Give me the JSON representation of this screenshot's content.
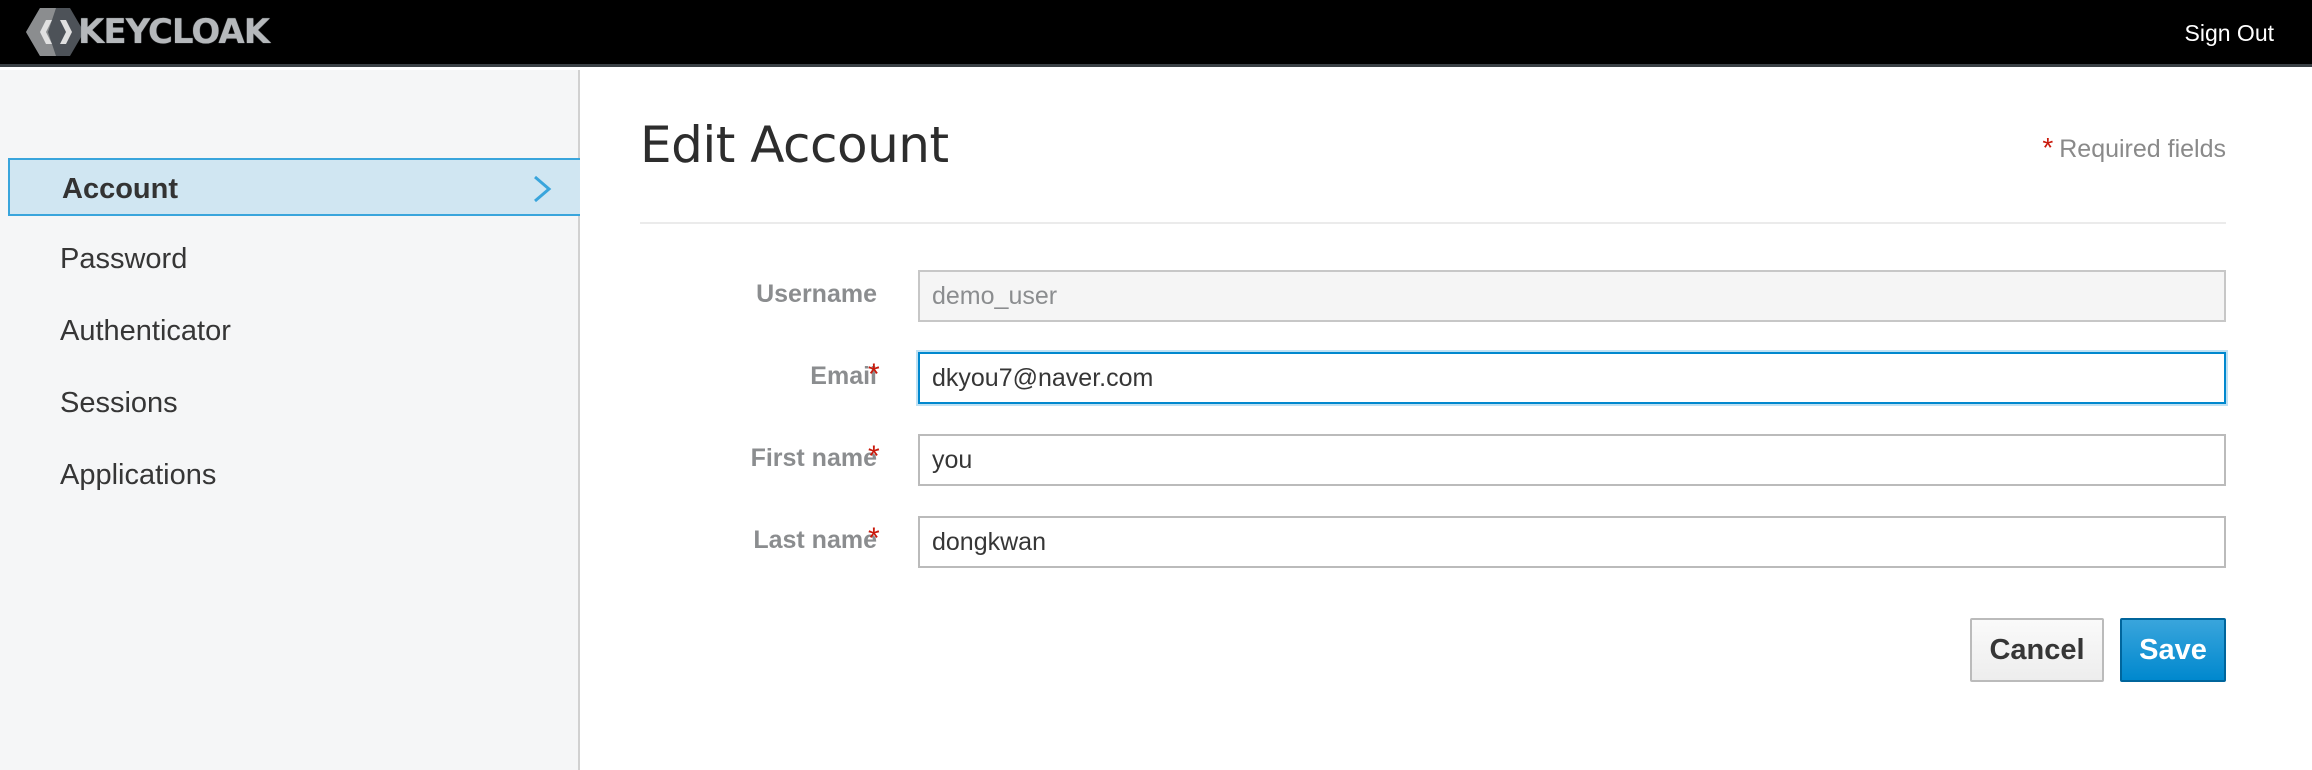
{
  "header": {
    "logo_text": "KEYCLOAK",
    "signout_label": "Sign Out"
  },
  "sidebar": {
    "items": [
      {
        "label": "Account",
        "active": true
      },
      {
        "label": "Password",
        "active": false
      },
      {
        "label": "Authenticator",
        "active": false
      },
      {
        "label": "Sessions",
        "active": false
      },
      {
        "label": "Applications",
        "active": false
      }
    ]
  },
  "main": {
    "title": "Edit Account",
    "required_note": "Required fields",
    "required_marker": "*",
    "fields": [
      {
        "label": "Username",
        "value": "demo_user",
        "required": false,
        "readonly": true
      },
      {
        "label": "Email",
        "value": "dkyou7@naver.com",
        "required": true,
        "readonly": false
      },
      {
        "label": "First name",
        "value": "you",
        "required": true,
        "readonly": false
      },
      {
        "label": "Last name",
        "value": "dongkwan",
        "required": true,
        "readonly": false
      }
    ],
    "cancel_label": "Cancel",
    "save_label": "Save"
  },
  "colors": {
    "header_bg": "#000000",
    "sidebar_bg": "#f5f6f7",
    "active_item_bg": "#d0e6f2",
    "active_item_border": "#39a5dc",
    "required_star": "#c9190b",
    "primary_button": "#0088ce"
  },
  "icons": {
    "logo": "keycloak-logo-icon",
    "active_chevron": "chevron-right-icon"
  }
}
